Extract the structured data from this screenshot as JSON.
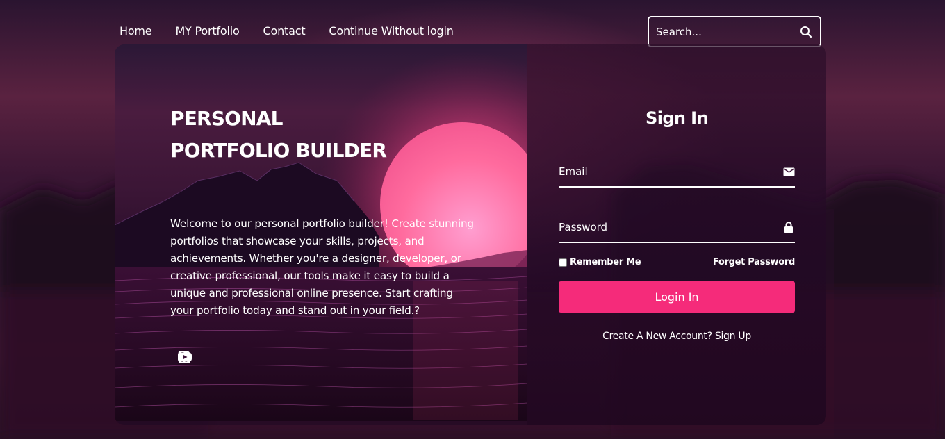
{
  "nav": {
    "links": [
      "Home",
      "MY Portfolio",
      "Contact",
      "Continue Without login"
    ]
  },
  "search": {
    "placeholder": "Search...",
    "icon": "search-icon"
  },
  "hero": {
    "title_line1": "PERSONAL",
    "title_line2": "PORTFOLIO BUILDER",
    "description": "Welcome to our personal portfolio builder! Create stunning portfolios that showcase your skills, projects, and achievements. Whether you're a designer, developer, or creative professional, our tools make it easy to build a unique and professional online presence. Start crafting your portfolio today and stand out in your field.?",
    "socials": [
      "instagram-icon",
      "facebook-icon",
      "linkedin-icon",
      "youtube-icon"
    ]
  },
  "signin": {
    "title": "Sign In",
    "email_placeholder": "Email",
    "password_placeholder": "Password",
    "remember_label": "Remember Me",
    "forget_label": "Forget Password",
    "login_label": "Login In",
    "signup_label": "Create A New Account? Sign Up"
  },
  "colors": {
    "accent": "#f52b7a",
    "sun": "#ff6fa0"
  }
}
